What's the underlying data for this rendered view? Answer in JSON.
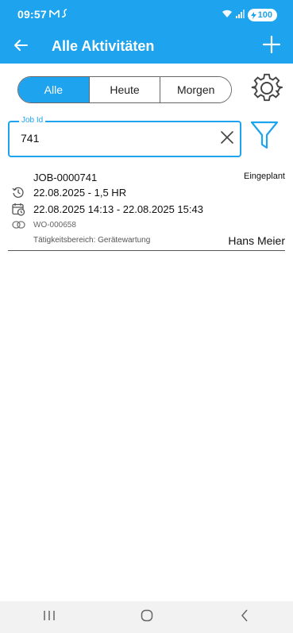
{
  "status_bar": {
    "time": "09:57",
    "battery": "100",
    "icons": [
      "gmail-icon",
      "app-notification-icon",
      "wifi-icon",
      "signal-icon",
      "battery-icon"
    ]
  },
  "app_bar": {
    "title": "Alle Aktivitäten",
    "back_icon": "arrow-left-icon",
    "add_icon": "plus-icon"
  },
  "filter_tabs": {
    "items": [
      {
        "label": "Alle",
        "selected": true
      },
      {
        "label": "Heute",
        "selected": false
      },
      {
        "label": "Morgen",
        "selected": false
      }
    ]
  },
  "search": {
    "label": "Job Id",
    "value": "741"
  },
  "jobs": [
    {
      "id": "JOB-0000741",
      "status": "Eingeplant",
      "duration": "22.08.2025 - 1,5 HR",
      "schedule": "22.08.2025 14:13 - 22.08.2025 15:43",
      "work_order": "WO-000658",
      "area": "Tätigkeitsbereich: Gerätewartung",
      "person": "Hans Meier"
    }
  ],
  "colors": {
    "primary": "#1ea3ee",
    "text": "#111111",
    "muted": "#666666",
    "nav_bg": "#f2f2f2"
  }
}
